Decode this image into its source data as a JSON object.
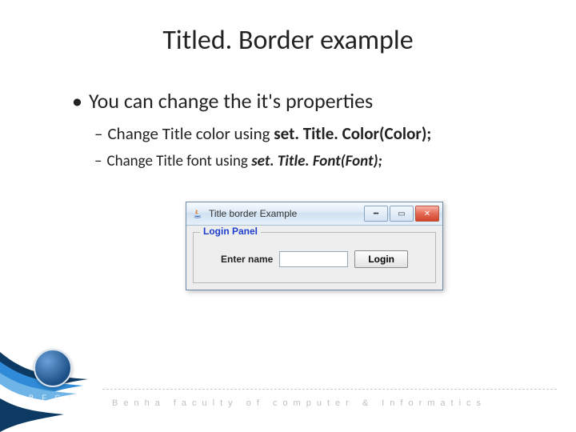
{
  "slide": {
    "title": "Titled. Border example",
    "bullet_main": "You can change the it's properties",
    "sub1_prefix": "Change Title color using ",
    "sub1_code": "set. Title. Color(Color);",
    "sub2_prefix": "Change Title font using  ",
    "sub2_code": "set. Title. Font(Font);"
  },
  "window": {
    "title": "Title border Example",
    "panel_title": "Login Panel",
    "label": "Enter name",
    "input_value": "",
    "button": "Login",
    "min_glyph": "━",
    "max_glyph": "▭",
    "close_glyph": "✕"
  },
  "footer": {
    "org_text": "Benha faculty of computer & Informatics",
    "bfci": "B F C I"
  }
}
